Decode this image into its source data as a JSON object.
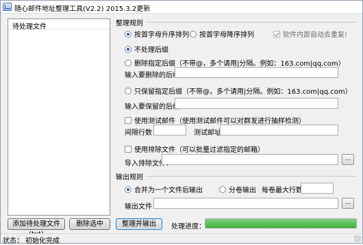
{
  "window": {
    "title": "随心邮件地址整理工具(V2.2)  2015.3.2更新"
  },
  "list": {
    "header": "待处理文件"
  },
  "rules": {
    "title": "整理规则",
    "sort_asc": "按首字母升序排列",
    "sort_desc": "按首字母降序排列",
    "auto_dedupe": "软件内部自动去重复!",
    "no_suffix": "不处理后缀",
    "delete_suffix": "删除指定后缀（不带@，多个请用|分隔。例如：163.com|qq.com）",
    "delete_suffix_label": "输入要删除的后缀：",
    "delete_suffix_value": "",
    "keep_suffix": "只保留指定后缀（不带@，多个请用|分隔。例如：163.com|qq.com）",
    "keep_suffix_label": "输入要保留的后缀：",
    "keep_suffix_value": "",
    "test_mail": "使用测试邮件（使用测试邮件可以对群发进行抽样检测）",
    "interval_label": "间隔行数：",
    "interval_value": "",
    "test_address_label": "测试邮址：",
    "test_address_value": "",
    "exclude_file": "使用排除文件（可以批量过滤指定的邮箱）",
    "import_exclude_label": "导入排除文件：",
    "import_exclude_value": "",
    "browse": "..."
  },
  "output": {
    "title": "输出规则",
    "merge": "合并为一个文件后输出",
    "split": "分卷输出",
    "max_rows_label": "每卷最大行数：",
    "max_rows_value": "",
    "file_label": "输出文件：",
    "file_value": "",
    "browse": "..."
  },
  "actions": {
    "add_file": "添加待处理文件(txt)",
    "remove": "删除选中",
    "process": "整理并输出",
    "progress_label": "处理进度：",
    "progress": 1.0
  },
  "status": {
    "label": "状态：",
    "text": "初始化完成"
  }
}
